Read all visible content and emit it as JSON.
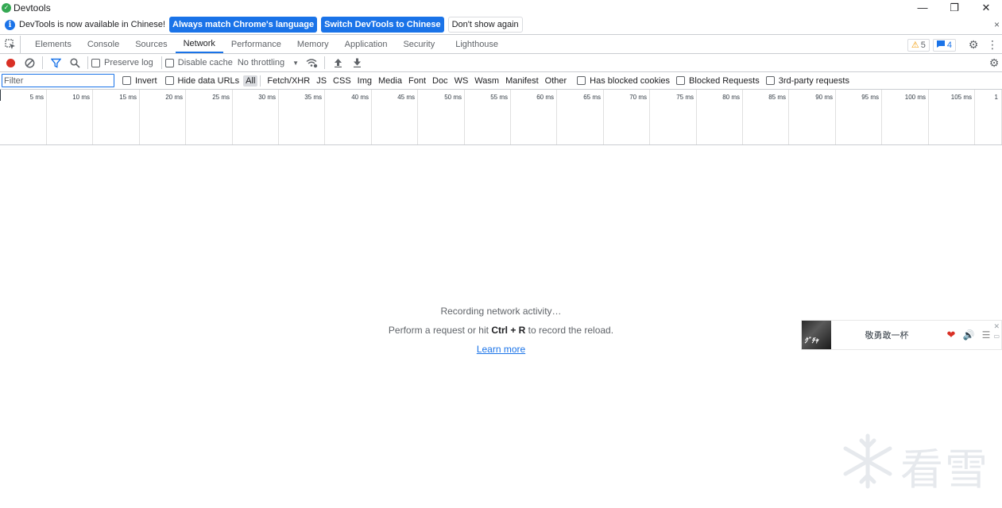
{
  "window": {
    "title": "Devtools",
    "minimize": "—",
    "restore": "❐",
    "close": "✕"
  },
  "infobar": {
    "message": "DevTools is now available in Chinese!",
    "match_button": "Always match Chrome's language",
    "switch_button": "Switch DevTools to Chinese",
    "dismiss_button": "Don't show again",
    "close": "×"
  },
  "tabs": {
    "items": [
      {
        "label": "Elements"
      },
      {
        "label": "Console"
      },
      {
        "label": "Sources"
      },
      {
        "label": "Network"
      },
      {
        "label": "Performance"
      },
      {
        "label": "Memory"
      },
      {
        "label": "Application"
      },
      {
        "label": "Security"
      },
      {
        "label": "Lighthouse"
      }
    ],
    "active": "Network",
    "warnings_count": "5",
    "messages_count": "4"
  },
  "toolbar": {
    "preserve_log": "Preserve log",
    "disable_cache": "Disable cache",
    "throttling": "No throttling",
    "throttling_caret": "▼"
  },
  "filterbar": {
    "placeholder": "Filter",
    "invert": "Invert",
    "hide_data_urls": "Hide data URLs",
    "types": [
      "All",
      "Fetch/XHR",
      "JS",
      "CSS",
      "Img",
      "Media",
      "Font",
      "Doc",
      "WS",
      "Wasm",
      "Manifest",
      "Other"
    ],
    "active_type": "All",
    "has_blocked_cookies": "Has blocked cookies",
    "blocked_requests": "Blocked Requests",
    "third_party": "3rd-party requests"
  },
  "timeline": {
    "ticks": [
      "5 ms",
      "10 ms",
      "15 ms",
      "20 ms",
      "25 ms",
      "30 ms",
      "35 ms",
      "40 ms",
      "45 ms",
      "50 ms",
      "55 ms",
      "60 ms",
      "65 ms",
      "70 ms",
      "75 ms",
      "80 ms",
      "85 ms",
      "90 ms",
      "95 ms",
      "100 ms",
      "105 ms"
    ],
    "trailing_tick": "1"
  },
  "empty_state": {
    "recording": "Recording network activity…",
    "hint_before": "Perform a request or hit ",
    "shortcut": "Ctrl + R",
    "hint_after": " to record the reload.",
    "learn_more": "Learn more"
  },
  "music_player": {
    "album_text": "ｸﾞﾁｬ",
    "song_title": "敬勇敢一杯",
    "like": "❤",
    "volume": "🔊",
    "playlist": "☰",
    "close": "✕",
    "mini": "▭"
  },
  "watermark": {
    "text": "看雪"
  }
}
